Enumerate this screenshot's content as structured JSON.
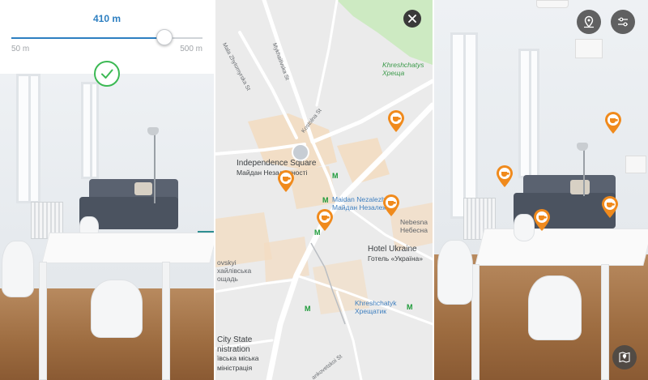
{
  "range_control": {
    "value_label": "410 m",
    "min_label": "50 m",
    "max_label": "500 m",
    "value_fraction": 0.8
  },
  "map": {
    "places": [
      {
        "id": "independence",
        "lines": [
          "Independence Square",
          "Майдан Незалежності"
        ]
      },
      {
        "id": "maidan",
        "lines": [
          "Maidan Nezalezh",
          "Майдан Незалежн"
        ]
      },
      {
        "id": "nebesna",
        "lines": [
          "Nebesna",
          "Небесна"
        ]
      },
      {
        "id": "hotel",
        "lines": [
          "Hotel Ukraine",
          "Готель «Україна»"
        ]
      },
      {
        "id": "khreshchatyk_top",
        "lines": [
          "Khreshchatys",
          "Хреща"
        ]
      },
      {
        "id": "khreshchatyk",
        "lines": [
          "Khreshchatyk",
          "Хрещатик"
        ]
      },
      {
        "id": "kovsky",
        "lines": [
          "ovskyi",
          "хайлівська",
          "ощадь"
        ]
      },
      {
        "id": "citystate",
        "lines": [
          "City State",
          "nistration",
          "ївська міська",
          "міністрація"
        ]
      }
    ],
    "streets": {
      "zhytomyrska": "Mala Zhytomyrska St",
      "mykhailivska": "Mykhailivska St",
      "kostolna": "Kostolna St",
      "ankovetskoi": "ankovetskoi St"
    }
  },
  "icons": {
    "confirm": "check-icon",
    "close": "close-icon",
    "map_pin_mode": "map-pin-icon",
    "filters": "filter-sliders-icon",
    "map_view": "map-location-icon",
    "poi": "coffee-cup-icon",
    "metro": "metro-icon"
  },
  "colors": {
    "accent": "#2d7fc1",
    "confirm": "#3cb954",
    "poi": "#f08a1c",
    "metro": "#1e9b3a"
  }
}
